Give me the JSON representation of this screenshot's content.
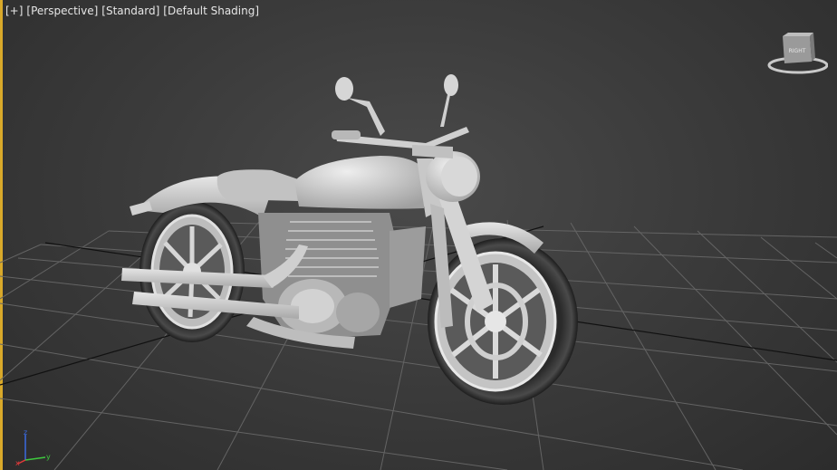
{
  "viewport": {
    "labels": {
      "plus": "[+]",
      "view": "[Perspective]",
      "shading_mode": "[Standard]",
      "style": "[Default Shading]"
    },
    "viewcube": {
      "face_label": "RIGHT"
    },
    "axis_tripod": {
      "x": "x",
      "y": "y",
      "z": "z"
    },
    "colors": {
      "active_border": "#d9a92a",
      "grid": "#6a6a6a",
      "model": "#c9c9c9",
      "axis_x": "#e03a3a",
      "axis_y": "#3ec93e",
      "axis_z": "#3a6ae0"
    }
  }
}
